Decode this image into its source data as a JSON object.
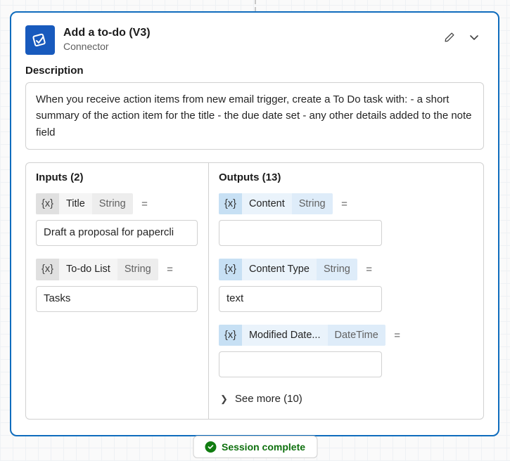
{
  "card": {
    "title": "Add a to-do (V3)",
    "subtitle": "Connector",
    "description_label": "Description",
    "description_text": "When you receive action items from new email trigger, create a To Do task with: - a short summary of the action item for the title - the due date set - any other details added to the note field"
  },
  "inputs": {
    "heading": "Inputs (2)",
    "params": [
      {
        "var": "{x}",
        "name": "Title",
        "type": "String",
        "eq": "=",
        "value": "Draft a proposal for papercli"
      },
      {
        "var": "{x}",
        "name": "To-do List",
        "type": "String",
        "eq": "=",
        "value": "Tasks"
      }
    ]
  },
  "outputs": {
    "heading": "Outputs (13)",
    "params": [
      {
        "var": "{x}",
        "name": "Content",
        "type": "String",
        "eq": "=",
        "value": ""
      },
      {
        "var": "{x}",
        "name": "Content Type",
        "type": "String",
        "eq": "=",
        "value": "text"
      },
      {
        "var": "{x}",
        "name": "Modified Date...",
        "type": "DateTime",
        "eq": "=",
        "value": ""
      }
    ],
    "see_more": "See more (10)"
  },
  "status": {
    "label": "Session complete"
  }
}
